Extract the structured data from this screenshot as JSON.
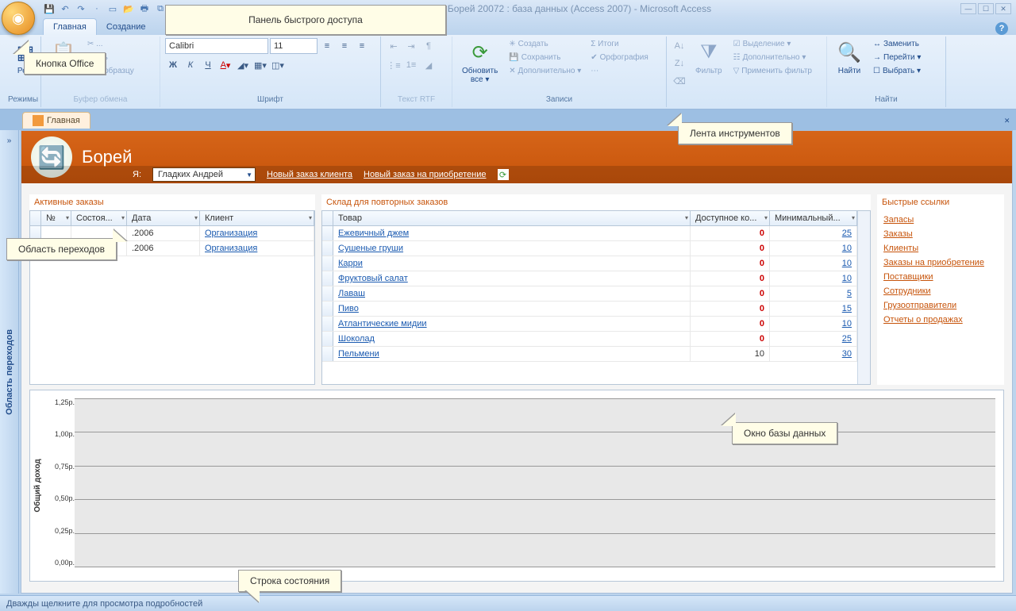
{
  "titlebar": {
    "app_title": "Борей 20072 : база данных (Access 2007) - Microsoft Access"
  },
  "tabs": {
    "home": "Главная",
    "create": "Создание"
  },
  "ribbon": {
    "groups": {
      "modes": "Режимы",
      "clipboard": "Буфер обмена",
      "font": "Шрифт",
      "rtf": "Текст RTF",
      "records": "Записи",
      "sortfilter": "",
      "find": "Найти"
    },
    "modes_btn": "Ре...",
    "paste": "Вст...",
    "paste2": "овать",
    "format_painter": "т по образцу",
    "font_name": "Calibri",
    "font_size": "11",
    "refresh": "Обновить\nвсе ▾",
    "new": "Создать",
    "save": "Сохранить",
    "delete": "✕ Дополнительно ▾",
    "totals": "Σ Итоги",
    "spell": "Орфография",
    "filter": "Фильтр",
    "selection": "Выделение ▾",
    "advanced": "Дополнительно ▾",
    "applyfilter": "Применить фильтр",
    "find_btn": "Найти",
    "replace": "Заменить",
    "goto": "Перейти ▾",
    "select": "Выбрать ▾"
  },
  "doctab": "Главная",
  "navpane_label": "Область переходов",
  "form": {
    "title": "Борей",
    "me_label": "Я:",
    "me_value": "Гладких Андрей",
    "new_order": "Новый заказ клиента",
    "new_purchase": "Новый заказ на приобретение"
  },
  "panels": {
    "active_orders": {
      "title": "Активные заказы",
      "cols": [
        "№",
        "Состоя...",
        "Дата",
        "Клиент"
      ],
      "rows": [
        {
          "no": "",
          "status": "",
          "date": ".2006",
          "client": "Организация"
        },
        {
          "no": "",
          "status": "",
          "date": ".2006",
          "client": "Организация"
        }
      ]
    },
    "stock": {
      "title": "Склад для повторных заказов",
      "cols": [
        "Товар",
        "Доступное ко...",
        "Минимальный..."
      ],
      "rows": [
        {
          "product": "Ежевичный джем",
          "avail": "0",
          "min": "25"
        },
        {
          "product": "Сушеные груши",
          "avail": "0",
          "min": "10"
        },
        {
          "product": "Карри",
          "avail": "0",
          "min": "10"
        },
        {
          "product": "Фруктовый салат",
          "avail": "0",
          "min": "10"
        },
        {
          "product": "Лаваш",
          "avail": "0",
          "min": "5"
        },
        {
          "product": "Пиво",
          "avail": "0",
          "min": "15"
        },
        {
          "product": "Атлантические мидии",
          "avail": "0",
          "min": "10"
        },
        {
          "product": "Шоколад",
          "avail": "0",
          "min": "25"
        },
        {
          "product": "Пельмени",
          "avail": "10",
          "min": "30"
        }
      ]
    },
    "quicklinks": {
      "title": "Быстрые ссылки",
      "items": [
        "Запасы",
        "Заказы",
        "Клиенты",
        "Заказы на приобретение",
        "Поставщики",
        "Сотрудники",
        "Грузоотправители",
        "Отчеты о продажах"
      ]
    }
  },
  "chart": {
    "ylabel": "Общий доход",
    "yticks": [
      "1,25p.",
      "1,00p.",
      "0,75p.",
      "0,50p.",
      "0,25p.",
      "0,00p."
    ]
  },
  "chart_data": {
    "type": "bar",
    "categories": [],
    "values": [],
    "title": "",
    "xlabel": "",
    "ylabel": "Общий доход",
    "ylim": [
      0,
      1.25
    ],
    "ytick_labels": [
      "0,00p.",
      "0,25p.",
      "0,50p.",
      "0,75p.",
      "1,00p.",
      "1,25p."
    ],
    "note": "chart is empty in the screenshot"
  },
  "statusbar": "Дважды щелкните для просмотра подробностей",
  "callouts": {
    "office_btn": "Кнопка Office",
    "qat": "Панель быстрого доступа",
    "nav": "Область переходов",
    "ribbon": "Лента инструментов",
    "dbwin": "Окно базы данных",
    "status": "Строка состояния"
  }
}
